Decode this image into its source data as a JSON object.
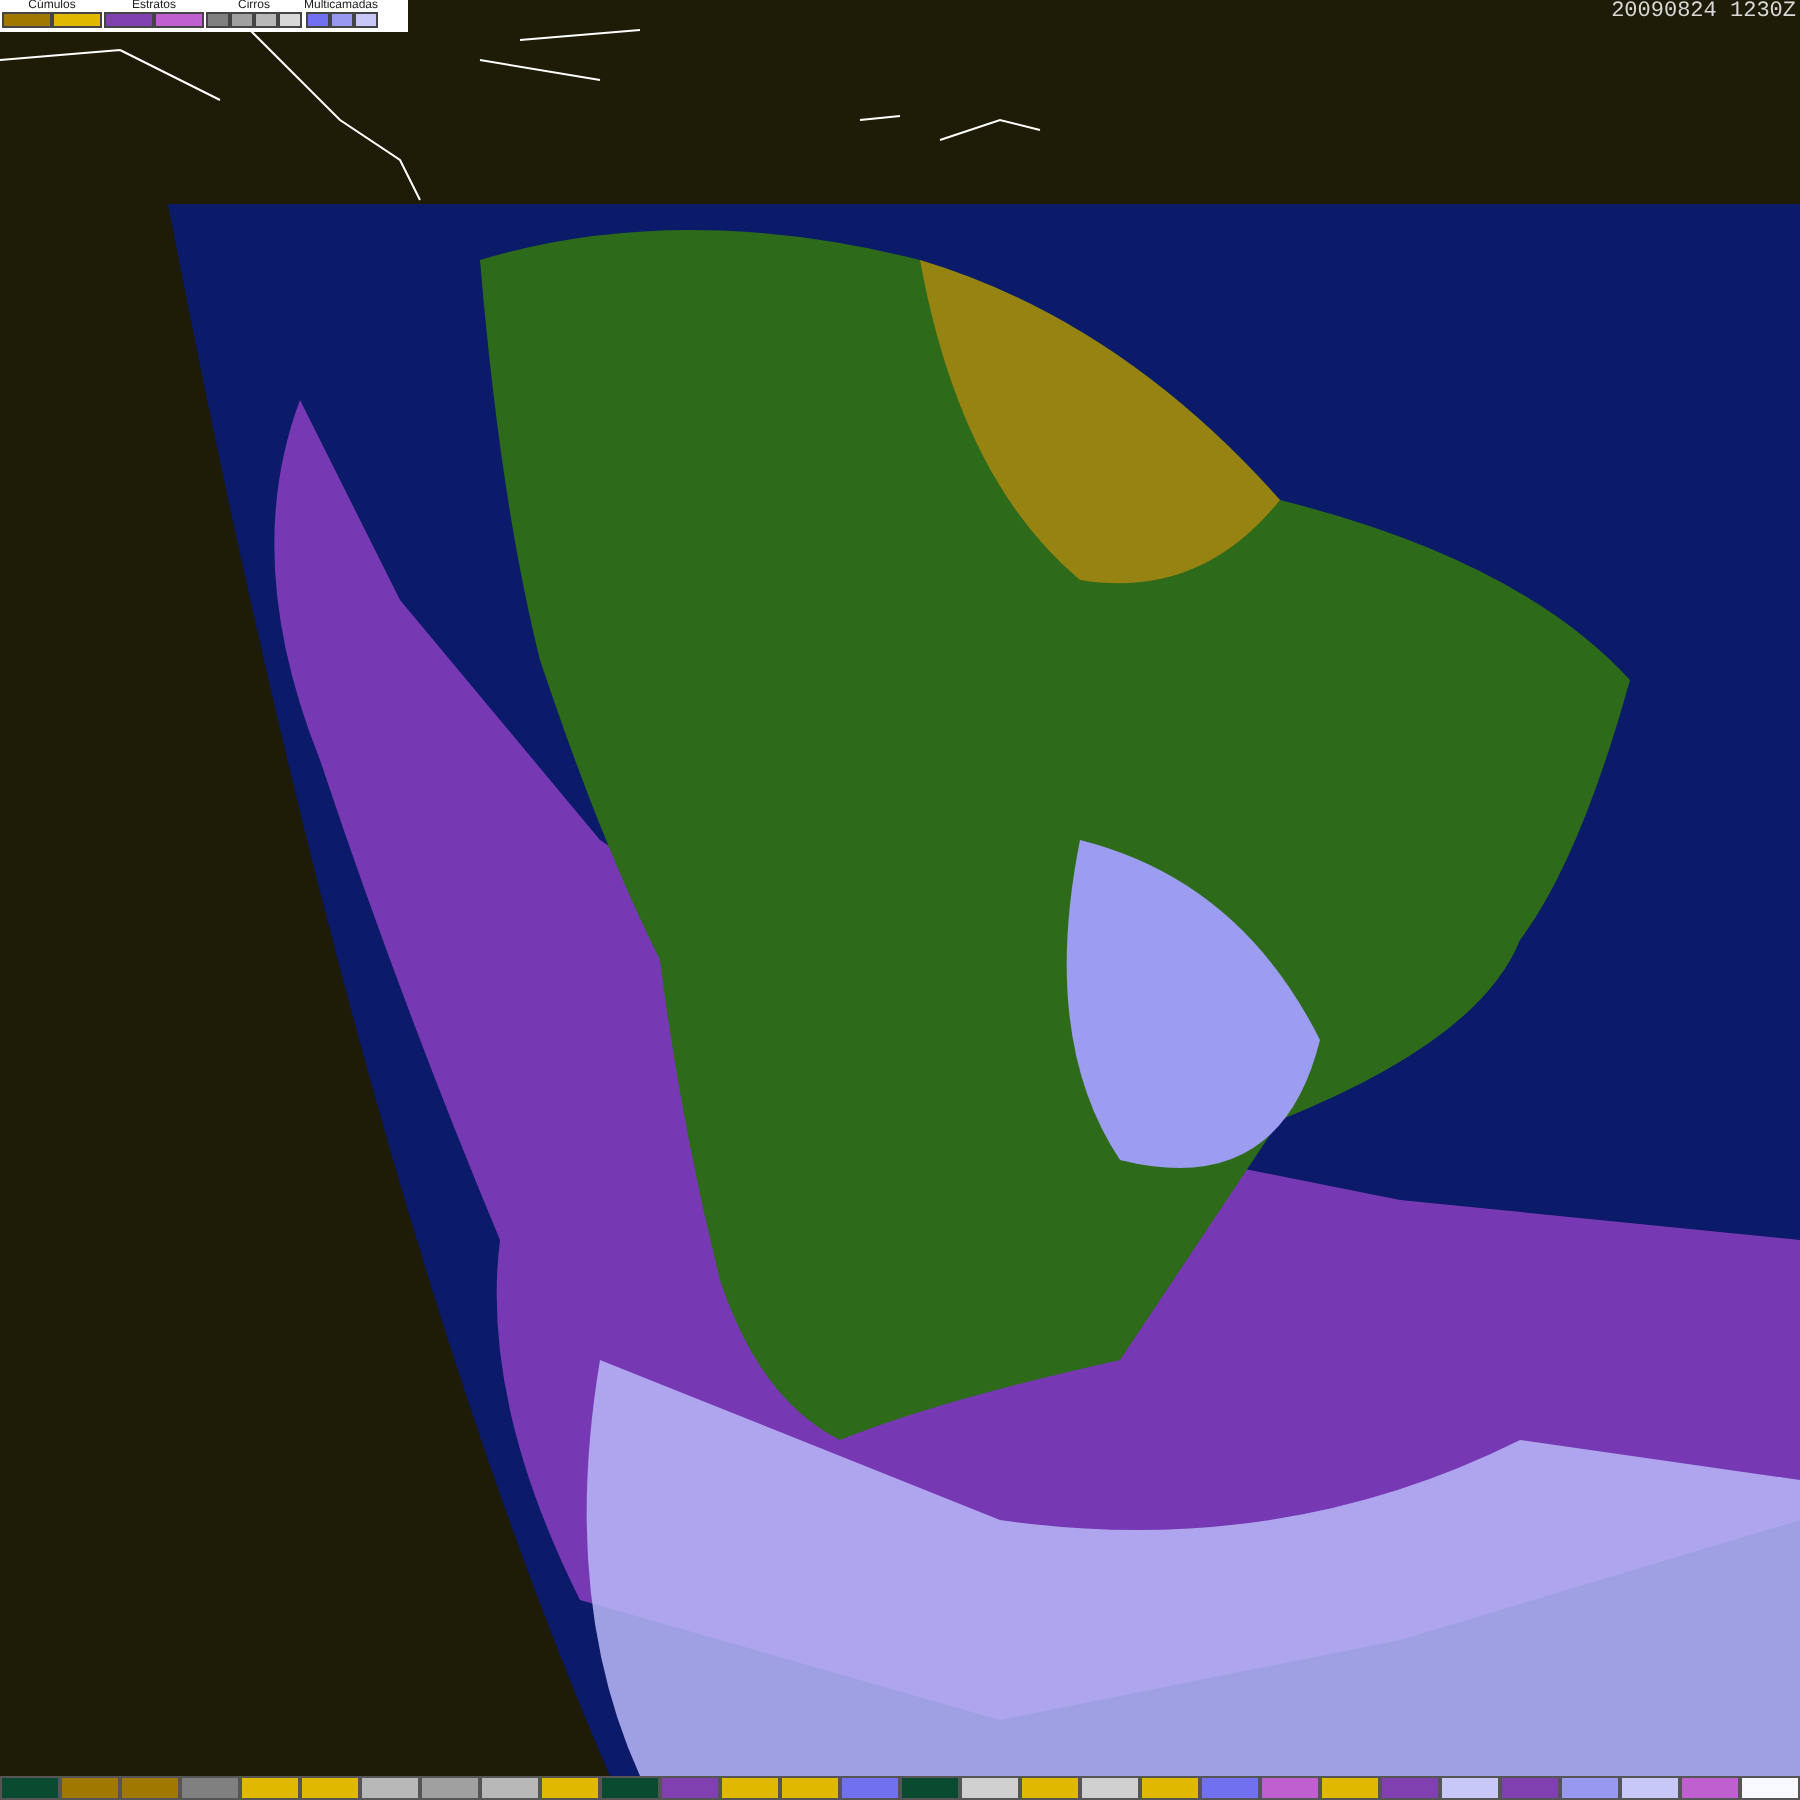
{
  "legend": {
    "groups": [
      {
        "label": "Cúmulos",
        "swatches": [
          {
            "color": "#a07800"
          },
          {
            "color": "#e0b800"
          }
        ]
      },
      {
        "label": "Estratos",
        "swatches": [
          {
            "color": "#8040b0"
          },
          {
            "color": "#c060d0"
          }
        ]
      },
      {
        "label": "Cirros",
        "swatches": [
          {
            "color": "#808080"
          },
          {
            "color": "#a0a0a0"
          },
          {
            "color": "#b8b8b8"
          },
          {
            "color": "#d8d8d8"
          }
        ]
      },
      {
        "label": "Multicamadas",
        "swatches": [
          {
            "color": "#7070f0"
          },
          {
            "color": "#9898f0"
          },
          {
            "color": "#c8c8f8"
          }
        ]
      }
    ]
  },
  "timestamp": "20090824 1230Z",
  "color_bar": [
    {
      "color": "#0a4a30"
    },
    {
      "color": "#a07800"
    },
    {
      "color": "#a07800"
    },
    {
      "color": "#808080"
    },
    {
      "color": "#e0b800"
    },
    {
      "color": "#e0b800"
    },
    {
      "color": "#b8b8b8"
    },
    {
      "color": "#a0a0a0"
    },
    {
      "color": "#b8b8b8"
    },
    {
      "color": "#e0b800"
    },
    {
      "color": "#0a4a30"
    },
    {
      "color": "#8040b0"
    },
    {
      "color": "#e0b800"
    },
    {
      "color": "#e0b800"
    },
    {
      "color": "#7070f0"
    },
    {
      "color": "#0a4a30"
    },
    {
      "color": "#d0d0d0"
    },
    {
      "color": "#e0b800"
    },
    {
      "color": "#d0d0d0"
    },
    {
      "color": "#e0b800"
    },
    {
      "color": "#7070f0"
    },
    {
      "color": "#c060d0"
    },
    {
      "color": "#e0b800"
    },
    {
      "color": "#8040b0"
    },
    {
      "color": "#c8c8f8"
    },
    {
      "color": "#8040b0"
    },
    {
      "color": "#9898f0"
    },
    {
      "color": "#c8c8f8"
    },
    {
      "color": "#c060d0"
    },
    {
      "color": "#f8f8ff"
    }
  ]
}
